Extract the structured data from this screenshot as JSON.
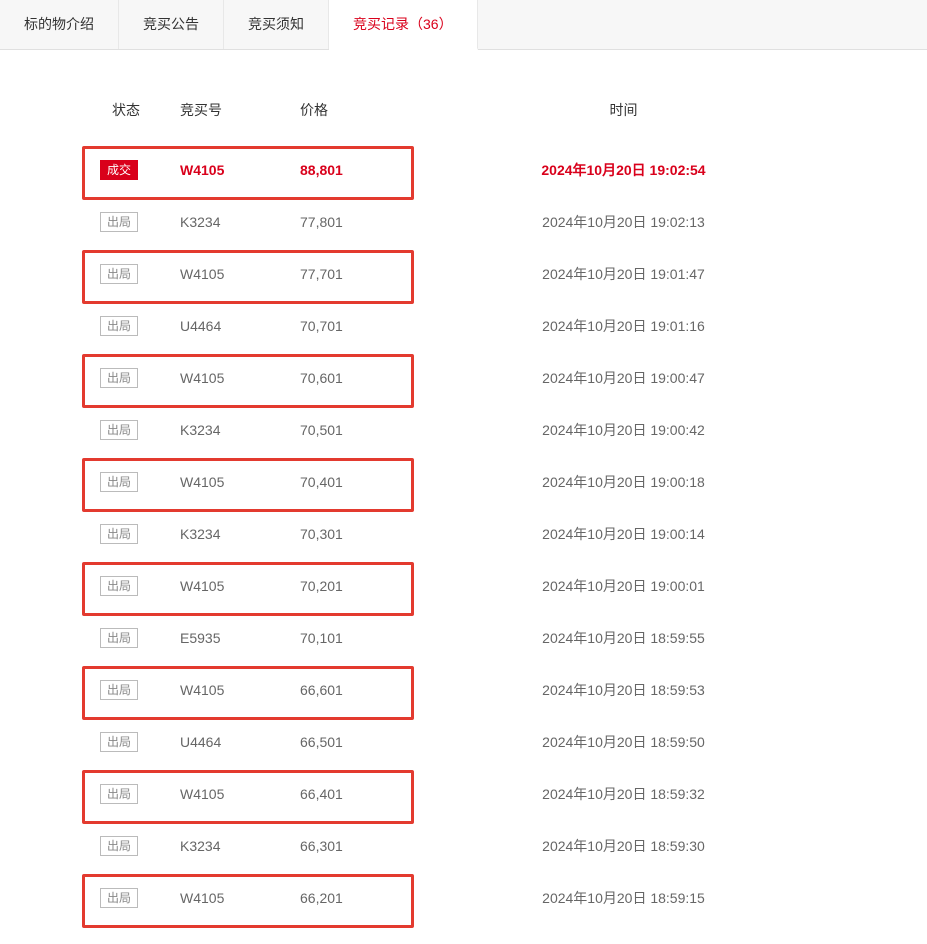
{
  "tabs": [
    {
      "label": "标的物介绍",
      "active": false
    },
    {
      "label": "竞买公告",
      "active": false
    },
    {
      "label": "竞买须知",
      "active": false
    },
    {
      "label": "竞买记录（36）",
      "active": true
    }
  ],
  "headers": {
    "status": "状态",
    "bidder": "竞买号",
    "price": "价格",
    "time": "时间"
  },
  "status_labels": {
    "deal": "成交",
    "out": "出局"
  },
  "records": [
    {
      "status": "deal",
      "bidder": "W4105",
      "price": "88,801",
      "time": "2024年10月20日 19:02:54",
      "winner": true,
      "highlight": true
    },
    {
      "status": "out",
      "bidder": "K3234",
      "price": "77,801",
      "time": "2024年10月20日 19:02:13",
      "winner": false,
      "highlight": false
    },
    {
      "status": "out",
      "bidder": "W4105",
      "price": "77,701",
      "time": "2024年10月20日 19:01:47",
      "winner": false,
      "highlight": true
    },
    {
      "status": "out",
      "bidder": "U4464",
      "price": "70,701",
      "time": "2024年10月20日 19:01:16",
      "winner": false,
      "highlight": false
    },
    {
      "status": "out",
      "bidder": "W4105",
      "price": "70,601",
      "time": "2024年10月20日 19:00:47",
      "winner": false,
      "highlight": true
    },
    {
      "status": "out",
      "bidder": "K3234",
      "price": "70,501",
      "time": "2024年10月20日 19:00:42",
      "winner": false,
      "highlight": false
    },
    {
      "status": "out",
      "bidder": "W4105",
      "price": "70,401",
      "time": "2024年10月20日 19:00:18",
      "winner": false,
      "highlight": true
    },
    {
      "status": "out",
      "bidder": "K3234",
      "price": "70,301",
      "time": "2024年10月20日 19:00:14",
      "winner": false,
      "highlight": false
    },
    {
      "status": "out",
      "bidder": "W4105",
      "price": "70,201",
      "time": "2024年10月20日 19:00:01",
      "winner": false,
      "highlight": true
    },
    {
      "status": "out",
      "bidder": "E5935",
      "price": "70,101",
      "time": "2024年10月20日 18:59:55",
      "winner": false,
      "highlight": false
    },
    {
      "status": "out",
      "bidder": "W4105",
      "price": "66,601",
      "time": "2024年10月20日 18:59:53",
      "winner": false,
      "highlight": true
    },
    {
      "status": "out",
      "bidder": "U4464",
      "price": "66,501",
      "time": "2024年10月20日 18:59:50",
      "winner": false,
      "highlight": false
    },
    {
      "status": "out",
      "bidder": "W4105",
      "price": "66,401",
      "time": "2024年10月20日 18:59:32",
      "winner": false,
      "highlight": true
    },
    {
      "status": "out",
      "bidder": "K3234",
      "price": "66,301",
      "time": "2024年10月20日 18:59:30",
      "winner": false,
      "highlight": false
    },
    {
      "status": "out",
      "bidder": "W4105",
      "price": "66,201",
      "time": "2024年10月20日 18:59:15",
      "winner": false,
      "highlight": true
    }
  ]
}
